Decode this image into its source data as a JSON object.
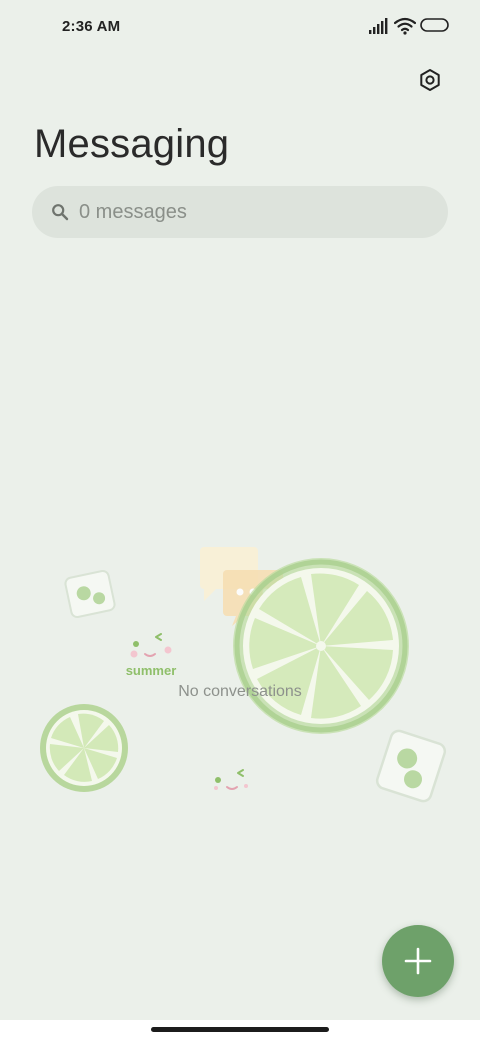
{
  "status_bar": {
    "time": "2:36 AM",
    "icons": [
      "signal-icon",
      "wifi-icon",
      "battery-icon"
    ]
  },
  "header": {
    "title": "Messaging",
    "settings_icon": "settings-icon"
  },
  "search": {
    "placeholder": "0 messages",
    "icon": "search-icon"
  },
  "empty_state": {
    "text": "No conversations",
    "illustration_text": "summer"
  },
  "fab": {
    "icon": "plus-icon"
  },
  "colors": {
    "background": "#ebf0ea",
    "search_bg": "#dde3dc",
    "fab": "#6ea16a",
    "lime_green": "#a9cf8e",
    "lime_light": "#d8ebbf"
  }
}
